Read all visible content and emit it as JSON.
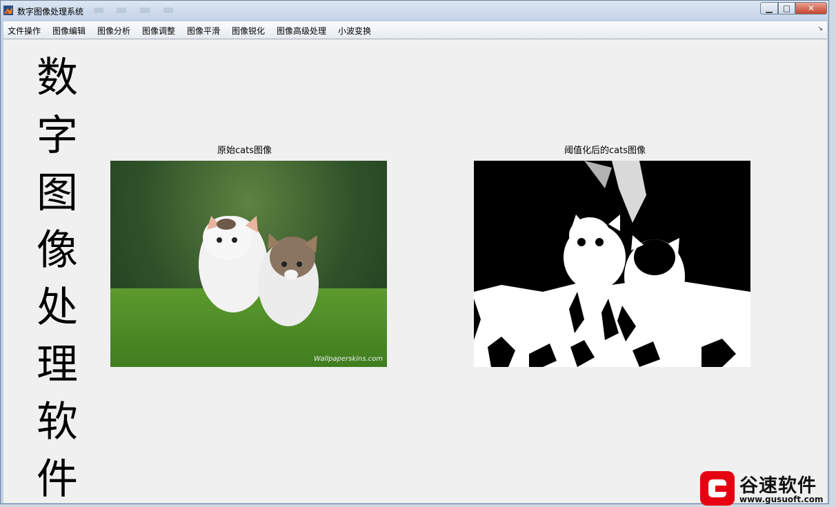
{
  "window": {
    "title": "数字图像处理系统",
    "controls": {
      "minimize": "▁",
      "maximize": "□",
      "close": "✕"
    }
  },
  "menubar": {
    "items": [
      {
        "label": "文件操作"
      },
      {
        "label": "图像编辑"
      },
      {
        "label": "图像分析"
      },
      {
        "label": "图像调整"
      },
      {
        "label": "图像平滑"
      },
      {
        "label": "图像锐化"
      },
      {
        "label": "图像高级处理"
      },
      {
        "label": "小波变换"
      }
    ],
    "overflow_glyph": "↘"
  },
  "banner": {
    "chars": [
      "数",
      "字",
      "图",
      "像",
      "处",
      "理",
      "软",
      "件"
    ]
  },
  "panels": {
    "original": {
      "title": "原始cats图像",
      "watermark": "Wallpaperskins.com"
    },
    "threshold": {
      "title": "阈值化后的cats图像"
    }
  },
  "logo": {
    "name": "谷速软件",
    "url": "www.gusuoft.com",
    "color": "#e60012"
  }
}
